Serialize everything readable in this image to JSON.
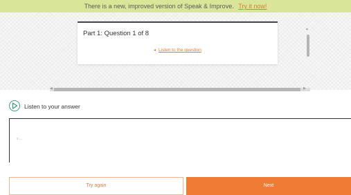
{
  "banner": {
    "message": "There is a new, improved version of Speak & Improve.",
    "link_label": "Try it now!"
  },
  "question": {
    "title": "Part 1: Question 1 of 8",
    "listen_label": "Listen to the question",
    "listen_icon": "speaker-icon"
  },
  "answer": {
    "listen_label": "Listen to your answer",
    "play_icon": "play-icon",
    "transcript": "x ..."
  },
  "actions": {
    "try_again_label": "Try again",
    "next_label": "Next"
  },
  "colors": {
    "banner": "#d9e69a",
    "accent": "#f07b35",
    "play_ring": "#3a9a7a"
  }
}
